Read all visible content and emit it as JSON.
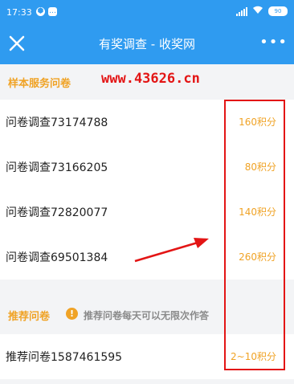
{
  "status_bar": {
    "time": "17:33",
    "battery": "90",
    "icons": [
      "shield-icon",
      "message-icon",
      "signal-icon",
      "wifi-icon",
      "battery-icon"
    ]
  },
  "nav": {
    "title": "有奖调查 - 收奖网",
    "close_icon": "close-icon",
    "more_icon": "more-icon",
    "more_glyph": "•••"
  },
  "sections": [
    {
      "title": "样本服务问卷",
      "watermark": "www.43626.cn",
      "items": [
        {
          "name": "问卷调查73174788",
          "points": "160积分"
        },
        {
          "name": "问卷调查73166205",
          "points": "80积分"
        },
        {
          "name": "问卷调查72820077",
          "points": "140积分"
        },
        {
          "name": "问卷调查69501384",
          "points": "260积分"
        }
      ]
    },
    {
      "title": "推荐问卷",
      "hint": "推荐问卷每天可以无限次作答",
      "hint_icon": "!",
      "items": [
        {
          "name": "推荐问卷1587461595",
          "points": "2~10积分"
        }
      ]
    }
  ],
  "colors": {
    "brand": "#2f9bf0",
    "accent": "#f0a326",
    "annotation": "#e31515",
    "background": "#f3f4f6"
  }
}
